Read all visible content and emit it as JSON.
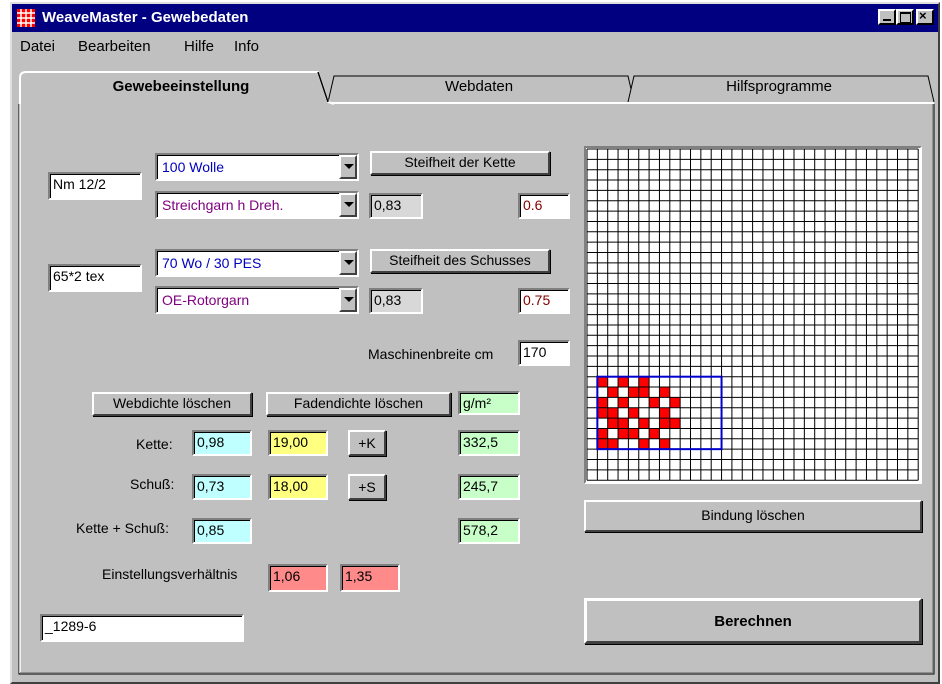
{
  "window": {
    "title": "WeaveMaster - Gewebedaten"
  },
  "menu": [
    "Datei",
    "Bearbeiten",
    "Hilfe",
    "Info"
  ],
  "tabs": [
    {
      "label": "Gewebeeinstellung",
      "active": true
    },
    {
      "label": "Webdaten",
      "active": false
    },
    {
      "label": "Hilfsprogramme",
      "active": false
    }
  ],
  "warp": {
    "count": "Nm 12/2",
    "material": "100 Wolle",
    "yarn_type": "Streichgarn h Dreh.",
    "stiffness_button": "Steifheit der Kette",
    "factor": "0,83",
    "value": "0.6"
  },
  "weft": {
    "count": "65*2 tex",
    "material": "70 Wo / 30 PES",
    "yarn_type": "OE-Rotorgarn",
    "stiffness_button": "Steifheit des Schusses",
    "factor": "0,83",
    "value": "0.75"
  },
  "machine": {
    "label": "Maschinenbreite cm",
    "value": "170"
  },
  "buttons": {
    "clear_weave_density": "Webdichte löschen",
    "clear_thread_density": "Fadendichte löschen",
    "plus_k": "+K",
    "plus_s": "+S",
    "clear_binding": "Bindung löschen",
    "calculate": "Berechnen"
  },
  "table": {
    "unit": "g/m²",
    "rows": [
      {
        "label": "Kette:",
        "cover": "0,98",
        "density": "19,00",
        "weight": "332,5"
      },
      {
        "label": "Schuß:",
        "cover": "0,73",
        "density": "18,00",
        "weight": "245,7"
      },
      {
        "label": "Kette + Schuß:",
        "cover": "0,85",
        "weight": "578,2"
      }
    ]
  },
  "ratio": {
    "label": "Einstellungsverhältnis",
    "value1": "1,06",
    "value2": "1,35"
  },
  "code_field": "_1289-6",
  "weave_colors": {
    "filled": "#ff0000",
    "border": "#0000cc"
  },
  "weave_pattern": [
    "10101000",
    "01011010",
    "10100101",
    "11010010",
    "01101011",
    "10110100",
    "11001010"
  ]
}
